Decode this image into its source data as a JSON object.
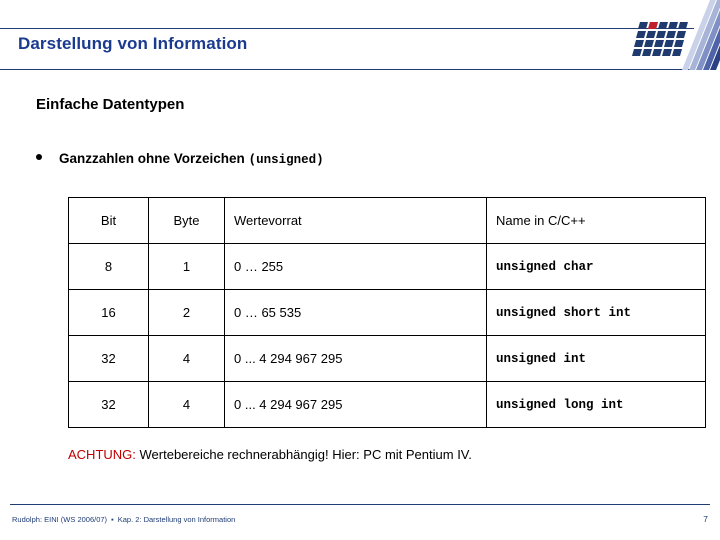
{
  "slide": {
    "title": "Darstellung von Information",
    "heading": "Einfache Datentypen",
    "bullet": {
      "text": "Ganzzahlen ohne Vorzeichen",
      "mono_suffix": "(unsigned)"
    },
    "note": {
      "warning_label": "ACHTUNG:",
      "body": " Wertebereiche rechnerabhängig! Hier: PC mit Pentium IV."
    },
    "footer": {
      "left": "Rudolph: EINI (WS 2006/07)",
      "separator": "▪",
      "chapter": "Kap. 2: Darstellung von Information",
      "page": "7"
    }
  },
  "table": {
    "headers": [
      "Bit",
      "Byte",
      "Wertevorrat",
      "Name in C/C++"
    ],
    "rows": [
      {
        "bit": "8",
        "byte": "1",
        "range": "0 … 255",
        "name": "unsigned char"
      },
      {
        "bit": "16",
        "byte": "2",
        "range": "0 … 65 535",
        "name": "unsigned short int"
      },
      {
        "bit": "32",
        "byte": "4",
        "range": "0 ... 4 294 967 295",
        "name": "unsigned int"
      },
      {
        "bit": "32",
        "byte": "4",
        "range": "0 ... 4 294 967 295",
        "name": "unsigned long int"
      }
    ]
  },
  "colors": {
    "title_blue": "#1b3b8f",
    "rule_blue": "#1f3c75",
    "warning_red": "#c00000",
    "logo_navy": "#1f3a6e",
    "logo_red": "#c0202a"
  },
  "logo": {
    "name": "university-grid-logo"
  }
}
